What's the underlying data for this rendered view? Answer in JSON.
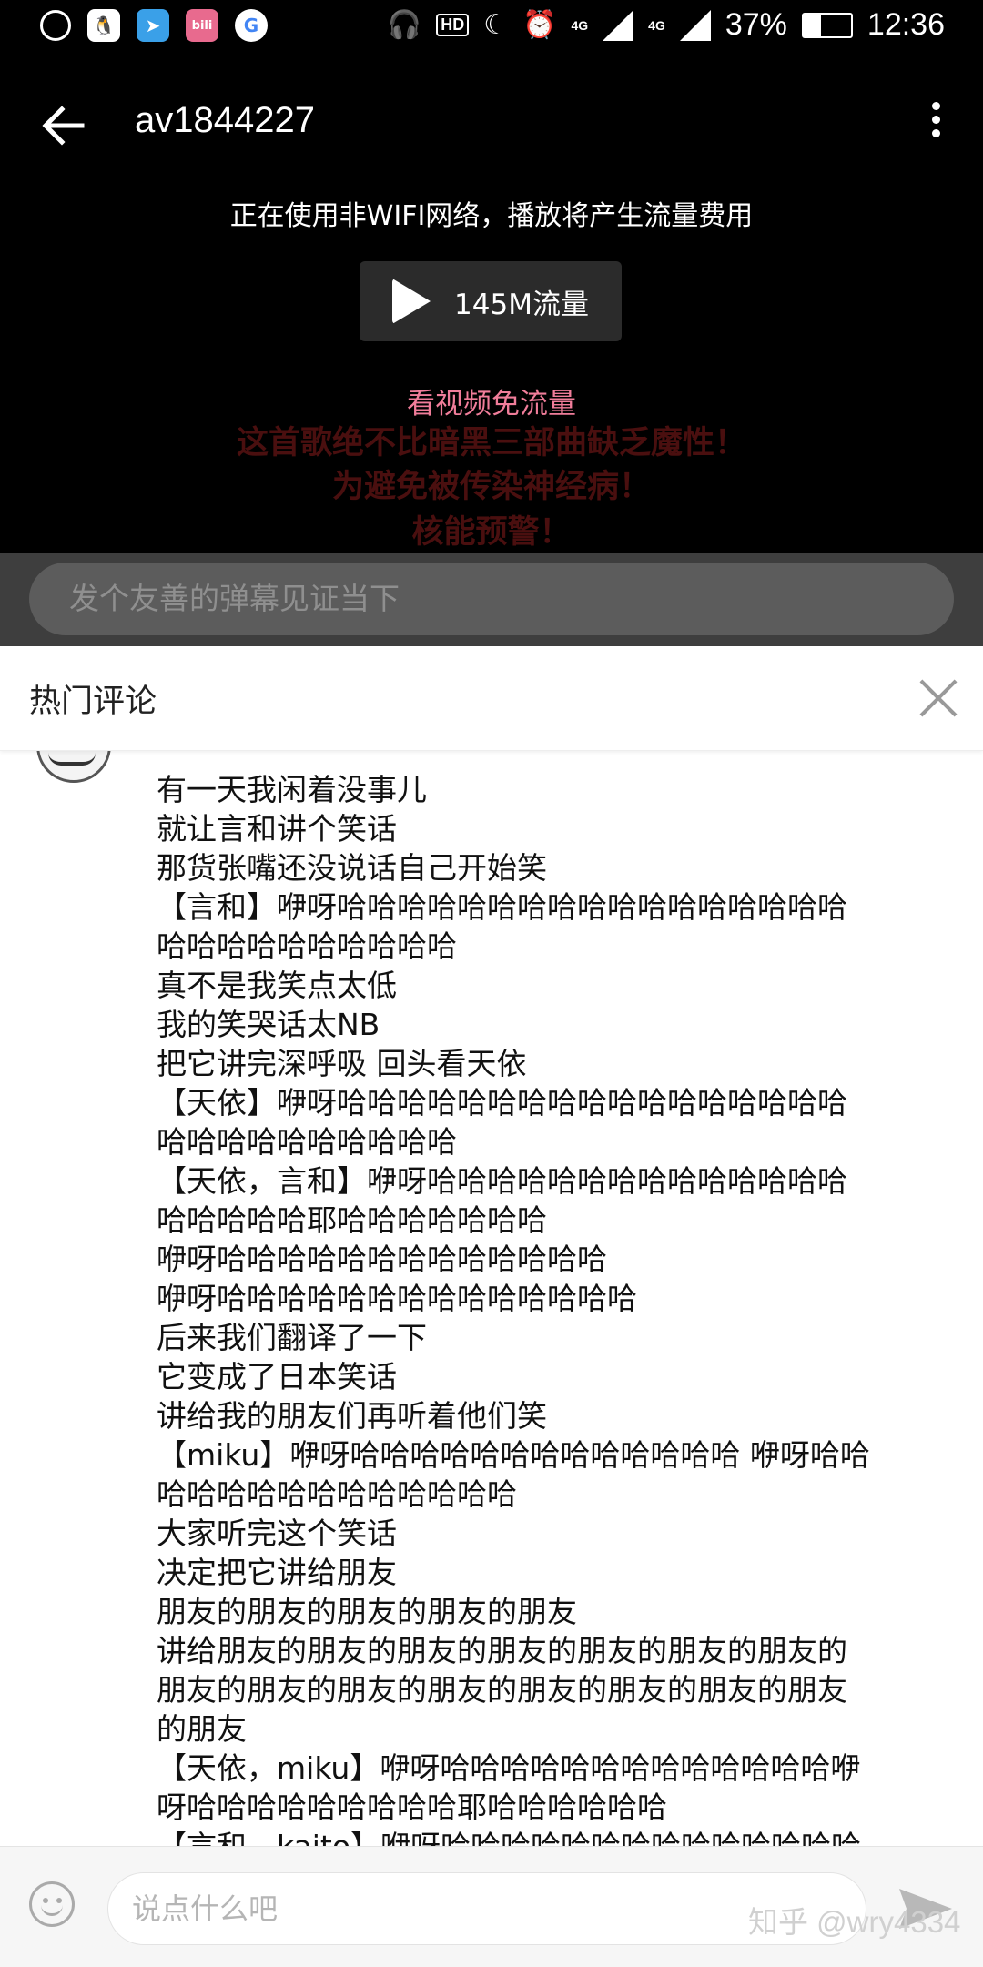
{
  "status_bar": {
    "network_4g_1": "4G",
    "network_4g_2": "4G",
    "hd_label": "HD",
    "battery": "37%",
    "time": "12:36"
  },
  "app_bar": {
    "title": "av1844227"
  },
  "player": {
    "network_warning": "正在使用非WIFI网络，播放将产生流量费用",
    "play_label": "145M流量",
    "free_data_link": "看视频免流量",
    "danmaku": [
      "这首歌绝不比暗黑三部曲缺乏魔性！",
      "为避免被传染神经病！",
      "核能预警！"
    ]
  },
  "danmaku_input": {
    "placeholder": "发个友善的弹幕见证当下"
  },
  "comments": {
    "header_title": "热门评论",
    "lines": [
      "有一天我闲着没事儿",
      "就让言和讲个笑话",
      "那货张嘴还没说话自己开始笑",
      "【言和】咿呀哈哈哈哈哈哈哈哈哈哈哈哈哈哈哈哈哈",
      "哈哈哈哈哈哈哈哈哈哈",
      "真不是我笑点太低",
      "我的笑哭话太NB",
      "把它讲完深呼吸 回头看天依",
      "【天依】咿呀哈哈哈哈哈哈哈哈哈哈哈哈哈哈哈哈哈",
      "哈哈哈哈哈哈哈哈哈哈",
      "【天依，言和】咿呀哈哈哈哈哈哈哈哈哈哈哈哈哈哈",
      "哈哈哈哈哈耶哈哈哈哈哈哈哈",
      "咿呀哈哈哈哈哈哈哈哈哈哈哈哈哈",
      "咿呀哈哈哈哈哈哈哈哈哈哈哈哈哈哈",
      "后来我们翻译了一下",
      "它变成了日本笑话",
      "讲给我的朋友们再听着他们笑",
      "【miku】咿呀哈哈哈哈哈哈哈哈哈哈哈哈哈 咿呀哈哈",
      "哈哈哈哈哈哈哈哈哈哈哈哈",
      "大家听完这个笑话",
      "决定把它讲给朋友",
      "朋友的朋友的朋友的朋友的朋友",
      "讲给朋友的朋友的朋友的朋友的朋友的朋友的朋友的",
      "朋友的朋友的朋友的朋友的朋友的朋友的朋友的朋友",
      "的朋友",
      "【天依，miku】咿呀哈哈哈哈哈哈哈哈哈哈哈哈哈咿",
      "呀哈哈哈哈哈哈哈哈哈耶哈哈哈哈哈哈",
      "【言和，kaito】咿呀哈哈哈哈哈哈哈哈哈哈哈哈哈哈"
    ]
  },
  "comment_input": {
    "placeholder": "说点什么吧"
  },
  "watermark": "知乎 @wry4334"
}
